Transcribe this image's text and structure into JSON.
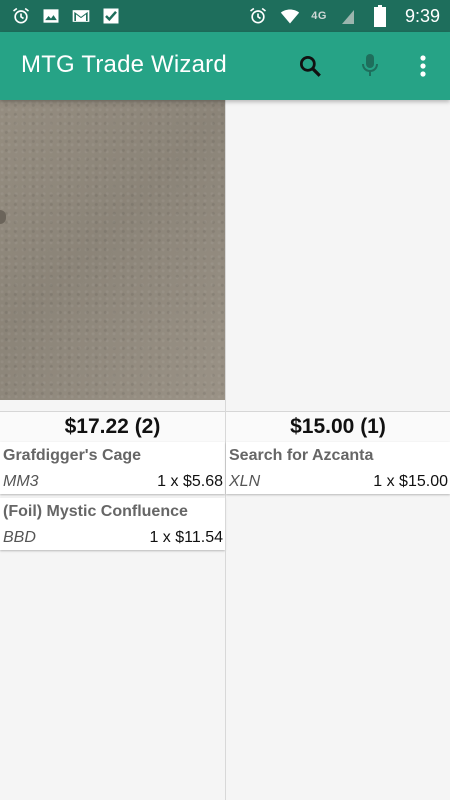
{
  "status_bar": {
    "left_icons": [
      "alarm-icon",
      "image-icon",
      "gmail-icon",
      "checkmark-app-icon"
    ],
    "right_icons": [
      "alarm-icon",
      "wifi-icon",
      "lte-signal-icon",
      "battery-icon"
    ],
    "network": "4G",
    "time": "9:39"
  },
  "app_bar": {
    "title": "MTG Trade Wizard",
    "actions": [
      "search-icon",
      "microphone-icon",
      "more-vert-icon"
    ]
  },
  "colors": {
    "status_bar": "#1e6e5c",
    "app_bar": "#26a386",
    "background": "#f5f5f5"
  },
  "left_column": {
    "total": "$17.22 (2)",
    "cards": [
      {
        "name": "Grafdigger's Cage",
        "set": "MM3",
        "price": "1 x $5.68"
      },
      {
        "name": "(Foil) Mystic Confluence",
        "set": "BBD",
        "price": "1 x $11.54"
      }
    ]
  },
  "right_column": {
    "total": "$15.00 (1)",
    "cards": [
      {
        "name": "Search for Azcanta",
        "set": "XLN",
        "price": "1 x $15.00"
      }
    ]
  }
}
